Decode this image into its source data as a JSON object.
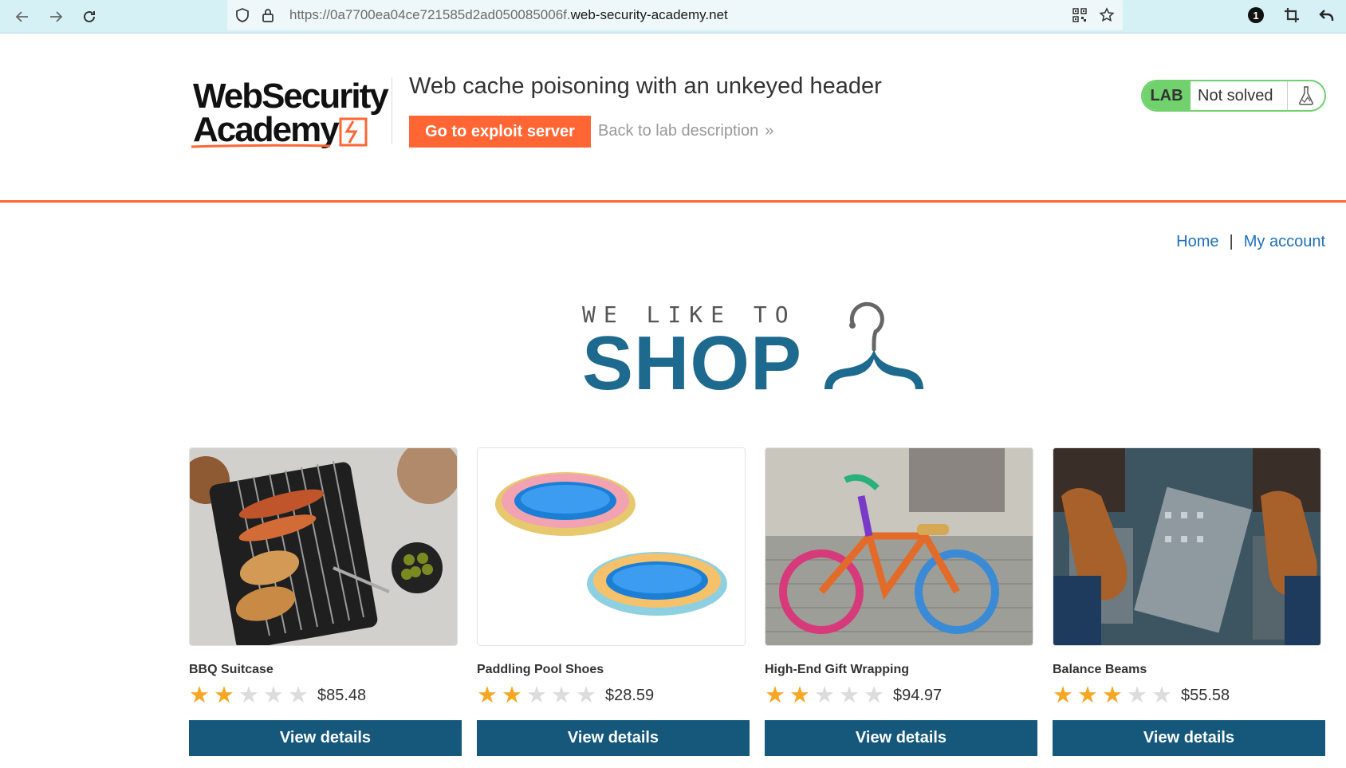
{
  "browser": {
    "url_prefix": "https://0a7700ea04ce721585d2ad050085006f.",
    "url_host": "web-security-academy.net",
    "badge_count": "1",
    "icons": [
      "back-arrow-icon",
      "forward-arrow-icon",
      "reload-icon",
      "shield-icon",
      "lock-icon",
      "qr-code-icon",
      "star-bookmark-icon",
      "crop-icon",
      "undo-icon"
    ]
  },
  "lab": {
    "logo_line1": "WebSecurity",
    "logo_line2": "Academy",
    "title": "Web cache poisoning with an unkeyed header",
    "exploit_button": "Go to exploit server",
    "back_link": "Back to lab description",
    "back_chevrons": "»",
    "status_badge": "LAB",
    "status_text": "Not solved",
    "accent_color": "#ff6633",
    "solved_color": "#70d16d"
  },
  "nav": {
    "home": "Home",
    "separator": "|",
    "account": "My account"
  },
  "banner": {
    "tagline": "WE LIKE TO",
    "title": "SHOP"
  },
  "products": [
    {
      "name": "BBQ Suitcase",
      "rating": 2,
      "price": "$85.48",
      "button": "View details"
    },
    {
      "name": "Paddling Pool Shoes",
      "rating": 2,
      "price": "$28.59",
      "button": "View details"
    },
    {
      "name": "High-End Gift Wrapping",
      "rating": 2,
      "price": "$94.97",
      "button": "View details"
    },
    {
      "name": "Balance Beams",
      "rating": 3,
      "price": "$55.58",
      "button": "View details"
    }
  ],
  "star_max": 5,
  "theme": {
    "button_color": "#15587c",
    "link_color": "#1e6fb8",
    "star_color": "#f5a623"
  }
}
